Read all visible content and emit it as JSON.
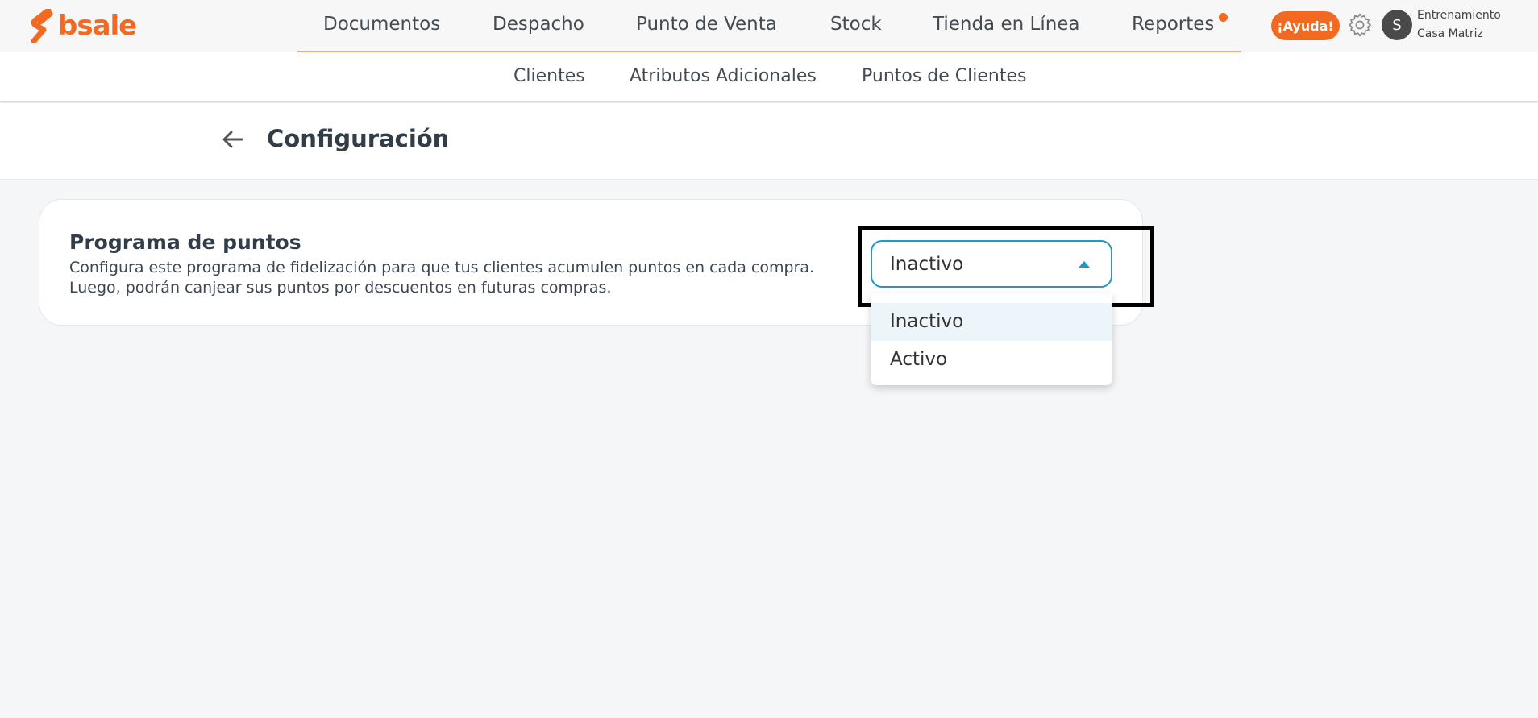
{
  "brand": {
    "name": "bsale",
    "color": "#f26a21"
  },
  "main_nav": {
    "items": [
      {
        "label": "Documentos"
      },
      {
        "label": "Despacho"
      },
      {
        "label": "Punto de Venta"
      },
      {
        "label": "Stock"
      },
      {
        "label": "Tienda en Línea"
      },
      {
        "label": "Reportes"
      }
    ]
  },
  "header_actions": {
    "help_label": "¡Ayuda!",
    "settings_icon": "gear-icon",
    "avatar_initial": "S",
    "user_name": "Entrenamiento",
    "branch": "Casa Matriz"
  },
  "sub_nav": {
    "items": [
      {
        "label": "Clientes"
      },
      {
        "label": "Atributos Adicionales"
      },
      {
        "label": "Puntos de Clientes"
      }
    ]
  },
  "page": {
    "back_icon": "arrow-left-icon",
    "title": "Configuración"
  },
  "card": {
    "title": "Programa de puntos",
    "description_line1": "Configura este programa de fidelización para que tus clientes acumulen puntos en cada compra.",
    "description_line2": "Luego, podrán canjear sus puntos por descuentos en futuras compras."
  },
  "status_select": {
    "value": "Inactivo",
    "expanded": true,
    "options": [
      {
        "label": "Inactivo",
        "selected": true
      },
      {
        "label": "Activo",
        "selected": false
      }
    ],
    "accent_color": "#1b9bc6"
  }
}
